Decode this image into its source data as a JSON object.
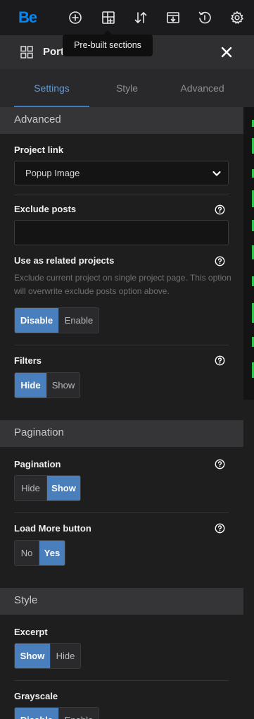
{
  "topbar": {
    "logo": "Be",
    "icons": [
      "add-icon",
      "prebuilt-sections-icon",
      "sort-icon",
      "import-icon",
      "history-icon",
      "gear-icon"
    ]
  },
  "tooltip": {
    "text": "Pre-built sections"
  },
  "panel": {
    "title": "Port"
  },
  "tabs": [
    {
      "label": "Settings",
      "active": true
    },
    {
      "label": "Style",
      "active": false
    },
    {
      "label": "Advanced",
      "active": false
    }
  ],
  "sections": {
    "advanced": "Advanced",
    "pagination": "Pagination",
    "style": "Style"
  },
  "fields": {
    "project_link": {
      "label": "Project link",
      "value": "Popup Image"
    },
    "exclude_posts": {
      "label": "Exclude posts",
      "value": ""
    },
    "related": {
      "label": "Use as related projects",
      "description": "Exclude current project on single project page. This option will overwrite exclude posts option above.",
      "options": [
        "Disable",
        "Enable"
      ],
      "selected": "Disable"
    },
    "filters": {
      "label": "Filters",
      "options": [
        "Hide",
        "Show"
      ],
      "selected": "Hide"
    },
    "pagination": {
      "label": "Pagination",
      "options": [
        "Hide",
        "Show"
      ],
      "selected": "Show"
    },
    "load_more": {
      "label": "Load More button",
      "options": [
        "No",
        "Yes"
      ],
      "selected": "Yes"
    },
    "excerpt": {
      "label": "Excerpt",
      "options": [
        "Show",
        "Hide"
      ],
      "selected": "Show"
    },
    "grayscale": {
      "label": "Grayscale",
      "options": [
        "Disable",
        "Enable"
      ],
      "selected": "Disable"
    }
  },
  "colors": {
    "accent": "#4a7fbd",
    "tab_active": "#5b9bd8",
    "logo": "#0089f7",
    "panel_bg": "#1e1e1e",
    "section_bg": "#353538"
  }
}
